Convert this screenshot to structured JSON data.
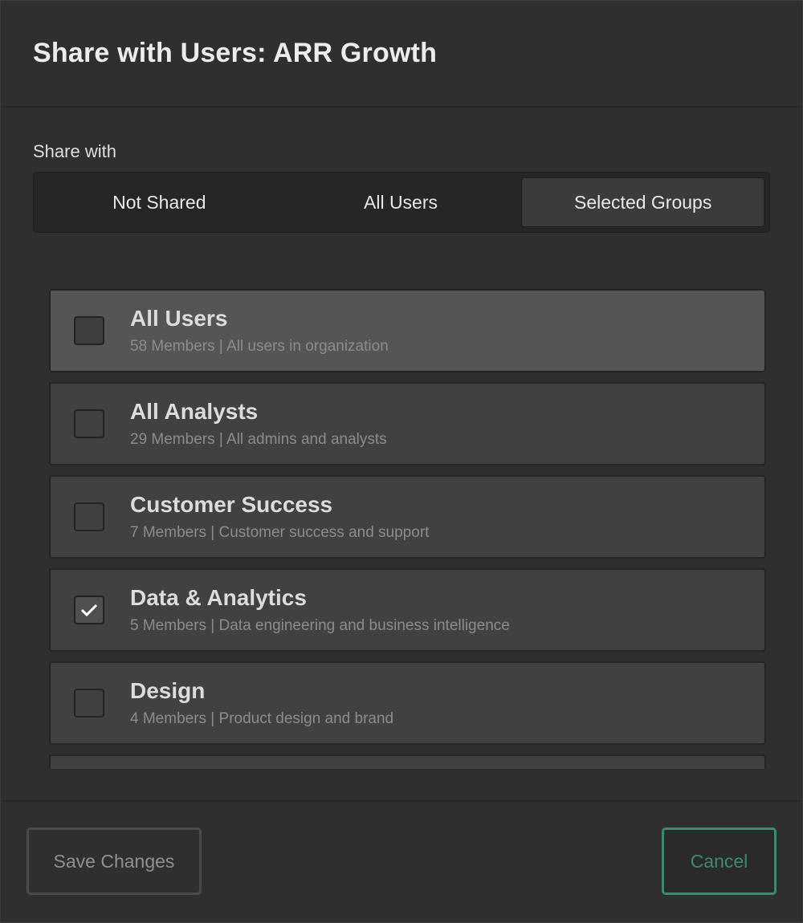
{
  "dialog": {
    "title": "Share with Users: ARR Growth"
  },
  "share_with": {
    "label": "Share with",
    "options": [
      {
        "label": "Not Shared",
        "active": false
      },
      {
        "label": "All Users",
        "active": false
      },
      {
        "label": "Selected Groups",
        "active": true
      }
    ]
  },
  "groups": [
    {
      "name": "All Users",
      "desc": "58 Members | All users in organization",
      "checked": false
    },
    {
      "name": "All Analysts",
      "desc": "29 Members | All admins and analysts",
      "checked": false
    },
    {
      "name": "Customer Success",
      "desc": "7 Members | Customer success and support",
      "checked": false
    },
    {
      "name": "Data & Analytics",
      "desc": "5 Members | Data engineering and business intelligence",
      "checked": true
    },
    {
      "name": "Design",
      "desc": "4 Members | Product design and brand",
      "checked": false
    }
  ],
  "footer": {
    "save_label": "Save Changes",
    "cancel_label": "Cancel"
  },
  "colors": {
    "accent": "#3e8a6c",
    "background": "#2f2f2f"
  }
}
